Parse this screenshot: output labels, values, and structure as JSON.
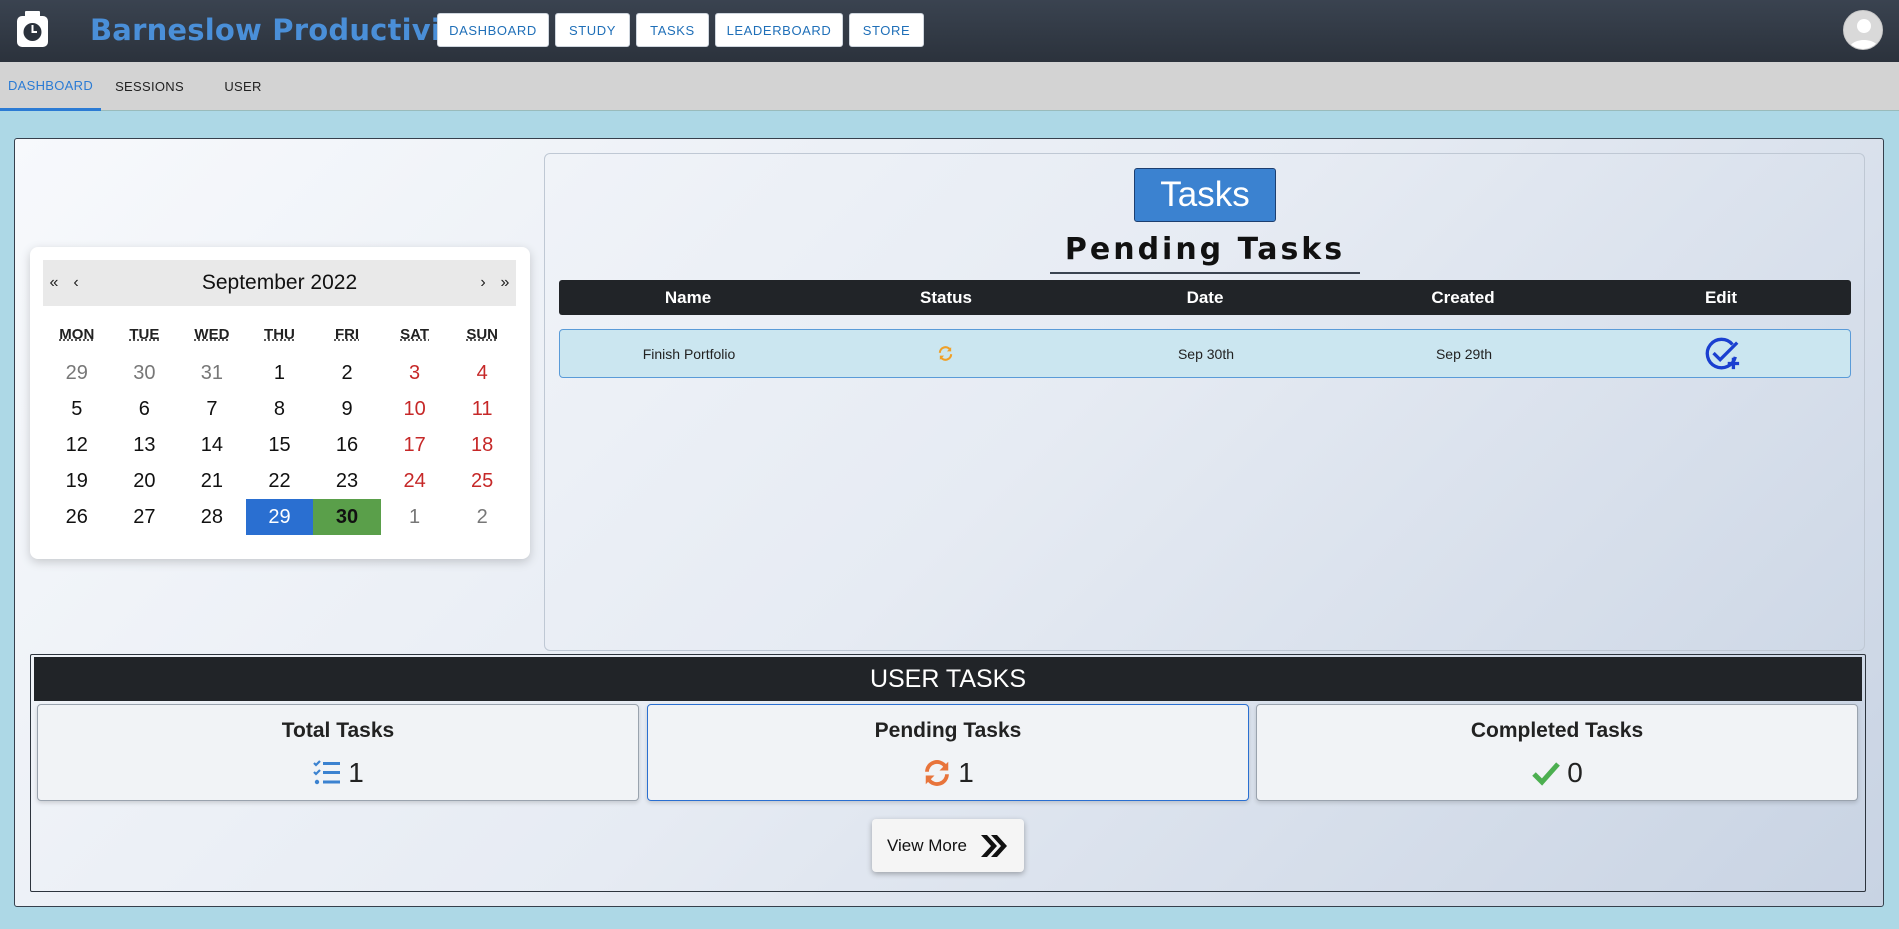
{
  "app": {
    "title": "Barneslow Productivity"
  },
  "topnav": [
    {
      "label": "DASHBOARD"
    },
    {
      "label": "STUDY"
    },
    {
      "label": "TASKS"
    },
    {
      "label": "LEADERBOARD"
    },
    {
      "label": "STORE"
    }
  ],
  "subnav": [
    {
      "label": "DASHBOARD",
      "active": true
    },
    {
      "label": "SESSIONS",
      "active": false
    },
    {
      "label": "USER",
      "active": false
    }
  ],
  "calendar": {
    "title": "September 2022",
    "nav": {
      "prev_year": "«",
      "prev_month": "‹",
      "next_month": "›",
      "next_year": "»"
    },
    "weekdays": [
      "MON",
      "TUE",
      "WED",
      "THU",
      "FRI",
      "SAT",
      "SUN"
    ],
    "weeks": [
      [
        "29",
        "30",
        "31",
        "1",
        "2",
        "3",
        "4"
      ],
      [
        "5",
        "6",
        "7",
        "8",
        "9",
        "10",
        "11"
      ],
      [
        "12",
        "13",
        "14",
        "15",
        "16",
        "17",
        "18"
      ],
      [
        "19",
        "20",
        "21",
        "22",
        "23",
        "24",
        "25"
      ],
      [
        "26",
        "27",
        "28",
        "29",
        "30",
        "1",
        "2"
      ]
    ],
    "today": "29",
    "selected": "30"
  },
  "tasks": {
    "button_label": "Tasks",
    "heading": "Pending Tasks",
    "columns": [
      "Name",
      "Status",
      "Date",
      "Created",
      "Edit"
    ],
    "rows": [
      {
        "name": "Finish Portfolio",
        "status_icon": "sync-icon",
        "date": "Sep 30th",
        "created": "Sep 29th",
        "edit_icon": "check-circle-plus-icon"
      }
    ]
  },
  "user_tasks": {
    "heading": "USER TASKS",
    "cards": [
      {
        "title": "Total Tasks",
        "value": "1",
        "icon": "list-check-icon",
        "color": "#3b82d0"
      },
      {
        "title": "Pending Tasks",
        "value": "1",
        "icon": "sync-icon",
        "color": "#e8743b"
      },
      {
        "title": "Completed Tasks",
        "value": "0",
        "icon": "checkmark-icon",
        "color": "#4caf50"
      }
    ],
    "view_more": "View More"
  },
  "colors": {
    "accent": "#3b82d0",
    "topbar": "#2f3742",
    "background": "#add8e6"
  }
}
